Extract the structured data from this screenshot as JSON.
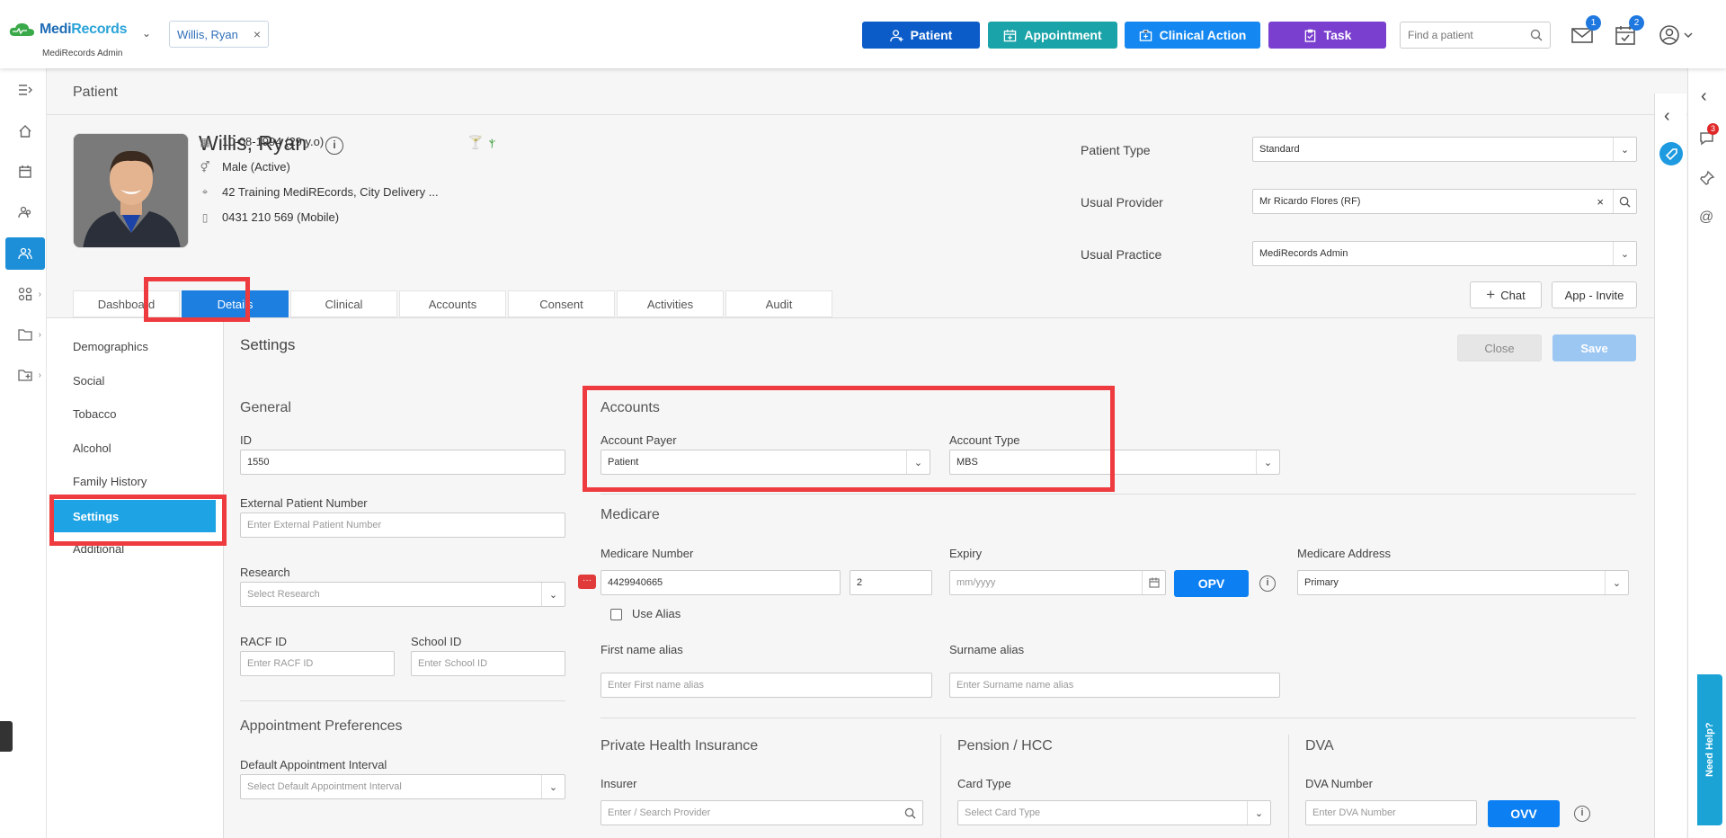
{
  "app": {
    "logo": "MediRecords",
    "logo_sub": "MediRecords Admin",
    "patient_chip": "Willis, Ryan"
  },
  "toolbar": {
    "patient": "Patient",
    "appointment": "Appointment",
    "clinical_action": "Clinical Action",
    "task": "Task",
    "search_placeholder": "Find a patient",
    "mail_count": "1",
    "tasks_count": "2",
    "colors": {
      "patient": "#0b5cc9",
      "appointment": "#1aa3a8",
      "clinical": "#1487f0",
      "task": "#7b3fd0"
    }
  },
  "page_title": "Patient",
  "patient": {
    "name": "Willis, Ryan",
    "dob": "10-08-1994 (29 y.o)",
    "gender": "Male (Active)",
    "address": "42 Training MediREcords, City Delivery ...",
    "phone": "0431 210 569 (Mobile)"
  },
  "patient_fields": {
    "type_label": "Patient Type",
    "type_value": "Standard",
    "provider_label": "Usual Provider",
    "provider_value": "Mr Ricardo Flores (RF)",
    "practice_label": "Usual Practice",
    "practice_value": "MediRecords Admin"
  },
  "tabs": [
    "Dashboard",
    "Details",
    "Clinical",
    "Accounts",
    "Consent",
    "Activities",
    "Audit"
  ],
  "actions": {
    "chat": "Chat",
    "app_invite": "App - Invite",
    "close": "Close",
    "save": "Save"
  },
  "left_nav": [
    "Demographics",
    "Social",
    "Tobacco",
    "Alcohol",
    "Family History",
    "Settings",
    "Additional"
  ],
  "settings": {
    "title": "Settings",
    "general": {
      "title": "General",
      "id_label": "ID",
      "id_value": "1550",
      "ext_label": "External Patient Number",
      "ext_placeholder": "Enter External Patient Number",
      "research_label": "Research",
      "research_placeholder": "Select Research",
      "racf_label": "RACF ID",
      "racf_placeholder": "Enter RACF ID",
      "school_label": "School ID",
      "school_placeholder": "Enter School ID"
    },
    "appointment_prefs": {
      "title": "Appointment Preferences",
      "interval_label": "Default Appointment Interval",
      "interval_placeholder": "Select Default Appointment Interval"
    },
    "accounts": {
      "title": "Accounts",
      "payer_label": "Account Payer",
      "payer_value": "Patient",
      "type_label": "Account Type",
      "type_value": "MBS"
    },
    "medicare": {
      "title": "Medicare",
      "number_label": "Medicare Number",
      "number_value": "4429940665",
      "irn_value": "2",
      "expiry_label": "Expiry",
      "expiry_placeholder": "mm/yyyy",
      "opv": "OPV",
      "address_label": "Medicare Address",
      "address_value": "Primary",
      "use_alias": "Use Alias",
      "first_alias_label": "First name alias",
      "first_alias_placeholder": "Enter First name alias",
      "surname_alias_label": "Surname alias",
      "surname_alias_placeholder": "Enter Surname name alias"
    },
    "phi": {
      "title": "Private Health Insurance",
      "insurer_label": "Insurer",
      "insurer_placeholder": "Enter / Search Provider"
    },
    "pension": {
      "title": "Pension / HCC",
      "card_label": "Card Type",
      "card_placeholder": "Select Card Type"
    },
    "dva": {
      "title": "DVA",
      "number_label": "DVA Number",
      "number_placeholder": "Enter DVA Number",
      "ovv": "OVV"
    }
  },
  "notif_count": "3",
  "help": "Need Help?"
}
